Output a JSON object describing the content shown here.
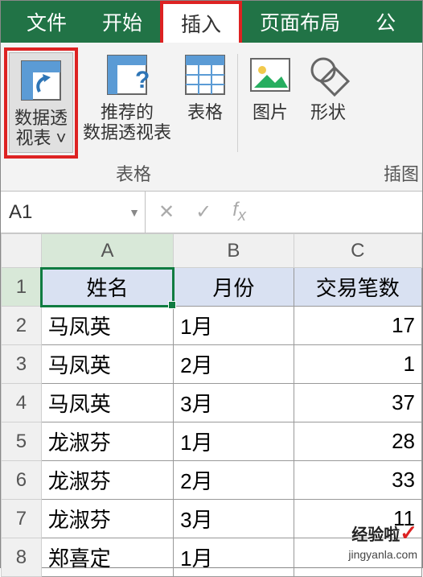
{
  "tabs": {
    "file": "文件",
    "home": "开始",
    "insert": "插入",
    "layout": "页面布局",
    "formula": "公"
  },
  "ribbon": {
    "pivot": "数据透\n视表 ˅",
    "recommend": "推荐的\n数据透视表",
    "table": "表格",
    "picture": "图片",
    "shape": "形状",
    "group_tables": "表格",
    "group_illus": "插图"
  },
  "namebox": "A1",
  "columns": [
    "A",
    "B",
    "C"
  ],
  "headers": {
    "name": "姓名",
    "month": "月份",
    "count": "交易笔数"
  },
  "rows": [
    {
      "n": "1"
    },
    {
      "n": "2",
      "name": "马凤英",
      "month": "1月",
      "count": "17"
    },
    {
      "n": "3",
      "name": "马凤英",
      "month": "2月",
      "count": "1"
    },
    {
      "n": "4",
      "name": "马凤英",
      "month": "3月",
      "count": "37"
    },
    {
      "n": "5",
      "name": "龙淑芬",
      "month": "1月",
      "count": "28"
    },
    {
      "n": "6",
      "name": "龙淑芬",
      "month": "2月",
      "count": "33"
    },
    {
      "n": "7",
      "name": "龙淑芬",
      "month": "3月",
      "count": "11"
    },
    {
      "n": "8",
      "name": "郑喜定",
      "month": "1月",
      "count": ""
    }
  ],
  "watermark": {
    "brand": "经验啦",
    "url": "jingyanla.com"
  }
}
